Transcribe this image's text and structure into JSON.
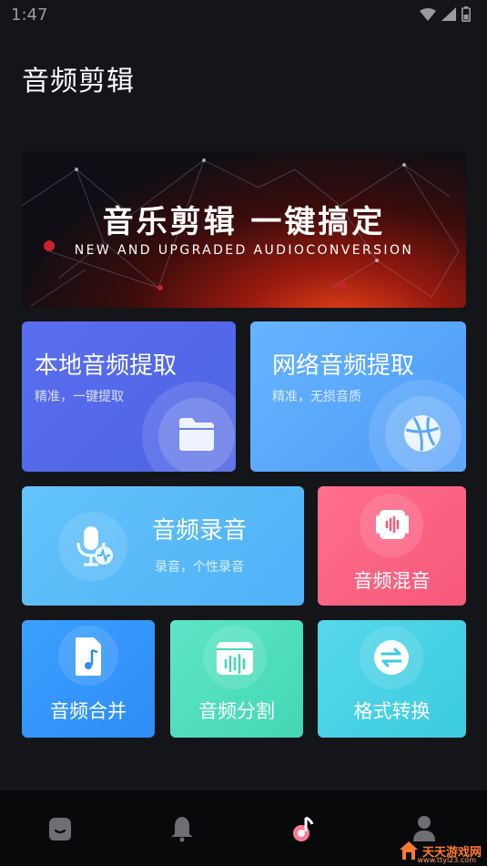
{
  "status": {
    "time": "1:47"
  },
  "page": {
    "title": "音频剪辑"
  },
  "banner": {
    "title": "音乐剪辑  一键搞定",
    "subtitle": "NEW AND UPGRADED AUDIOCONVERSION"
  },
  "cards": {
    "local_extract": {
      "title": "本地音频提取",
      "subtitle": "精准，一键提取",
      "icon": "folder-icon"
    },
    "network_extract": {
      "title": "网络音频提取",
      "subtitle": "精准，无损音质",
      "icon": "globe-icon"
    },
    "record": {
      "title": "音频录音",
      "subtitle": "录音，个性录音",
      "icon": "microphone-icon"
    },
    "mix": {
      "title": "音频混音",
      "icon": "mixer-icon"
    },
    "merge": {
      "title": "音频合并",
      "icon": "music-file-icon"
    },
    "split": {
      "title": "音频分割",
      "icon": "waveform-icon"
    },
    "convert": {
      "title": "格式转换",
      "icon": "swap-icon"
    }
  },
  "nav": [
    "home-icon",
    "bell-icon",
    "music-note-icon",
    "profile-icon"
  ],
  "watermark": {
    "text": "天天游戏网",
    "url": "www.ttyl23.com"
  },
  "colors": {
    "background": "#141519",
    "local": "#5068e8",
    "network": "#5aa8fb",
    "record": "#58b9f9",
    "mix": "#fb6383",
    "merge": "#3598fb",
    "split": "#4edfbd",
    "convert": "#48d1e5"
  }
}
